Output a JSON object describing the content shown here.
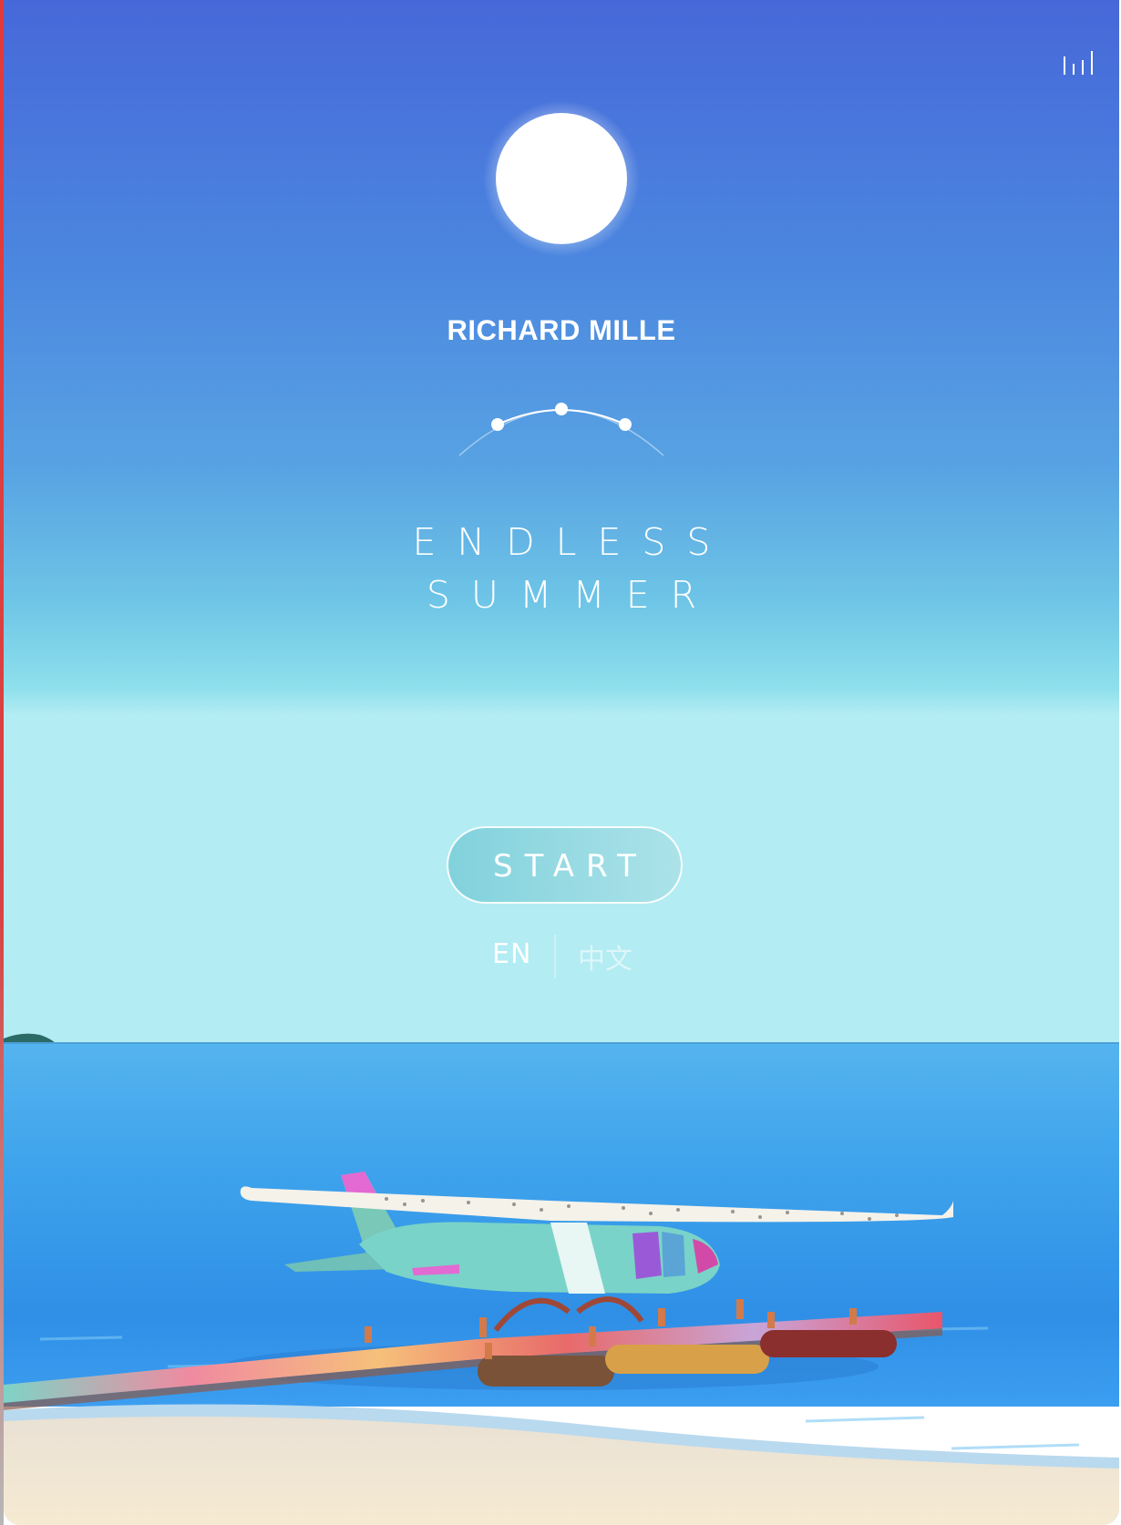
{
  "brand": {
    "name": "RICHARD MILLE"
  },
  "title": {
    "line1": "ENDLESS",
    "line2": "SUMMER"
  },
  "actions": {
    "start_label": "START"
  },
  "language": {
    "selected": "EN",
    "options": [
      "EN",
      "中文"
    ],
    "en_label": "EN",
    "zh_label": "中文"
  },
  "icons": {
    "sound": "sound-bars-icon",
    "sun": "sun-illustration",
    "emblem": "arc-dots-emblem"
  },
  "colors": {
    "sky_top": "#4a6fd8",
    "sky_mid": "#5aa6e6",
    "sky_horizon": "#a8e8f0",
    "sea": "#3fa6e8",
    "sand": "#f3e7cf",
    "accent_white": "#ffffff"
  }
}
